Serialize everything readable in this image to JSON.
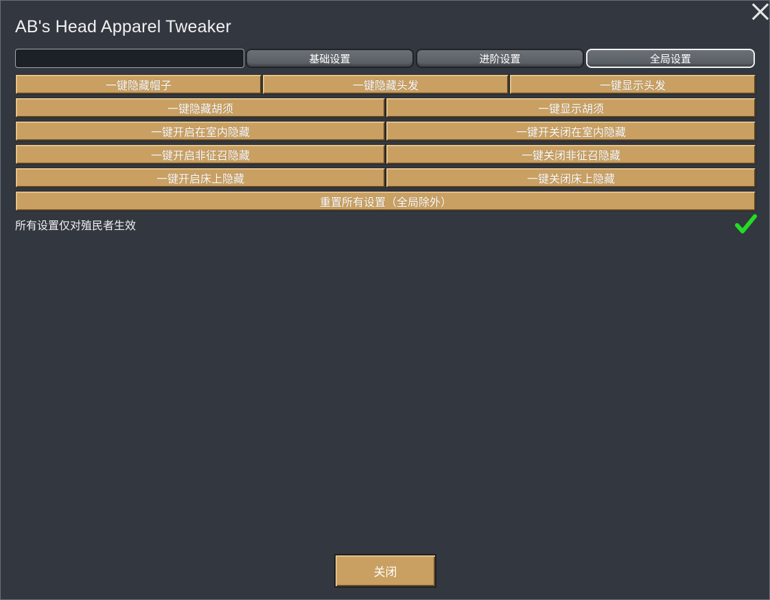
{
  "window": {
    "title": "AB's Head Apparel Tweaker"
  },
  "search": {
    "value": "",
    "placeholder": ""
  },
  "tabs": [
    {
      "label": "基础设置",
      "active": false
    },
    {
      "label": "进阶设置",
      "active": false
    },
    {
      "label": "全局设置",
      "active": true
    }
  ],
  "buttons": {
    "hide_hats": "一键隐藏帽子",
    "hide_hair": "一键隐藏头发",
    "show_hair": "一键显示头发",
    "hide_beard": "一键隐藏胡须",
    "show_beard": "一键显示胡须",
    "enable_indoor_hide": "一键开启在室内隐藏",
    "disable_indoor_hide": "一键开关闭在室内隐藏",
    "enable_undrafted_hide": "一键开启非征召隐藏",
    "disable_undrafted_hide": "一键关闭非征召隐藏",
    "enable_bed_hide": "一键开启床上隐藏",
    "disable_bed_hide": "一键关闭床上隐藏",
    "reset_all": "重置所有设置（全局除外）"
  },
  "option": {
    "label": "所有设置仅对殖民者生效",
    "checked": true,
    "check_color": "#22dd22"
  },
  "footer": {
    "close_label": "关闭"
  },
  "colors": {
    "button_fill": "#c9a062",
    "window_bg": "#333840"
  }
}
